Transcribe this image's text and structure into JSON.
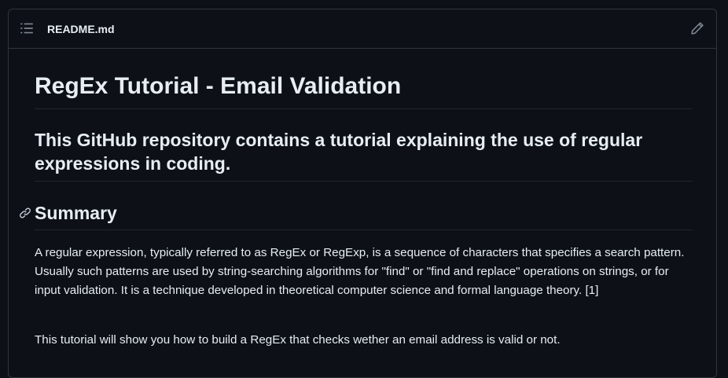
{
  "readme": {
    "file_name": "README.md",
    "title": "RegEx Tutorial - Email Validation",
    "subtitle": "This GitHub repository contains a tutorial explaining the use of regular expressions in coding.",
    "summary_heading": "Summary",
    "summary_paragraph": "A regular expression, typically referred to as RegEx or RegExp, is a sequence of characters that specifies a search pattern. Usually such patterns are used by string-searching algorithms for \"find\" or \"find and replace\" operations on strings, or for input validation. It is a technique developed in theoretical computer science and formal language theory. [1]",
    "intro_paragraph": "This tutorial will show you how to build a RegEx that checks wether an email address is valid or not."
  },
  "icons": {
    "toc": "list-unordered-icon",
    "edit": "pencil-icon",
    "anchor": "link-icon"
  },
  "colors": {
    "background": "#0d1117",
    "border": "#30363d",
    "text": "#e6edf3",
    "muted": "#7d8590"
  }
}
